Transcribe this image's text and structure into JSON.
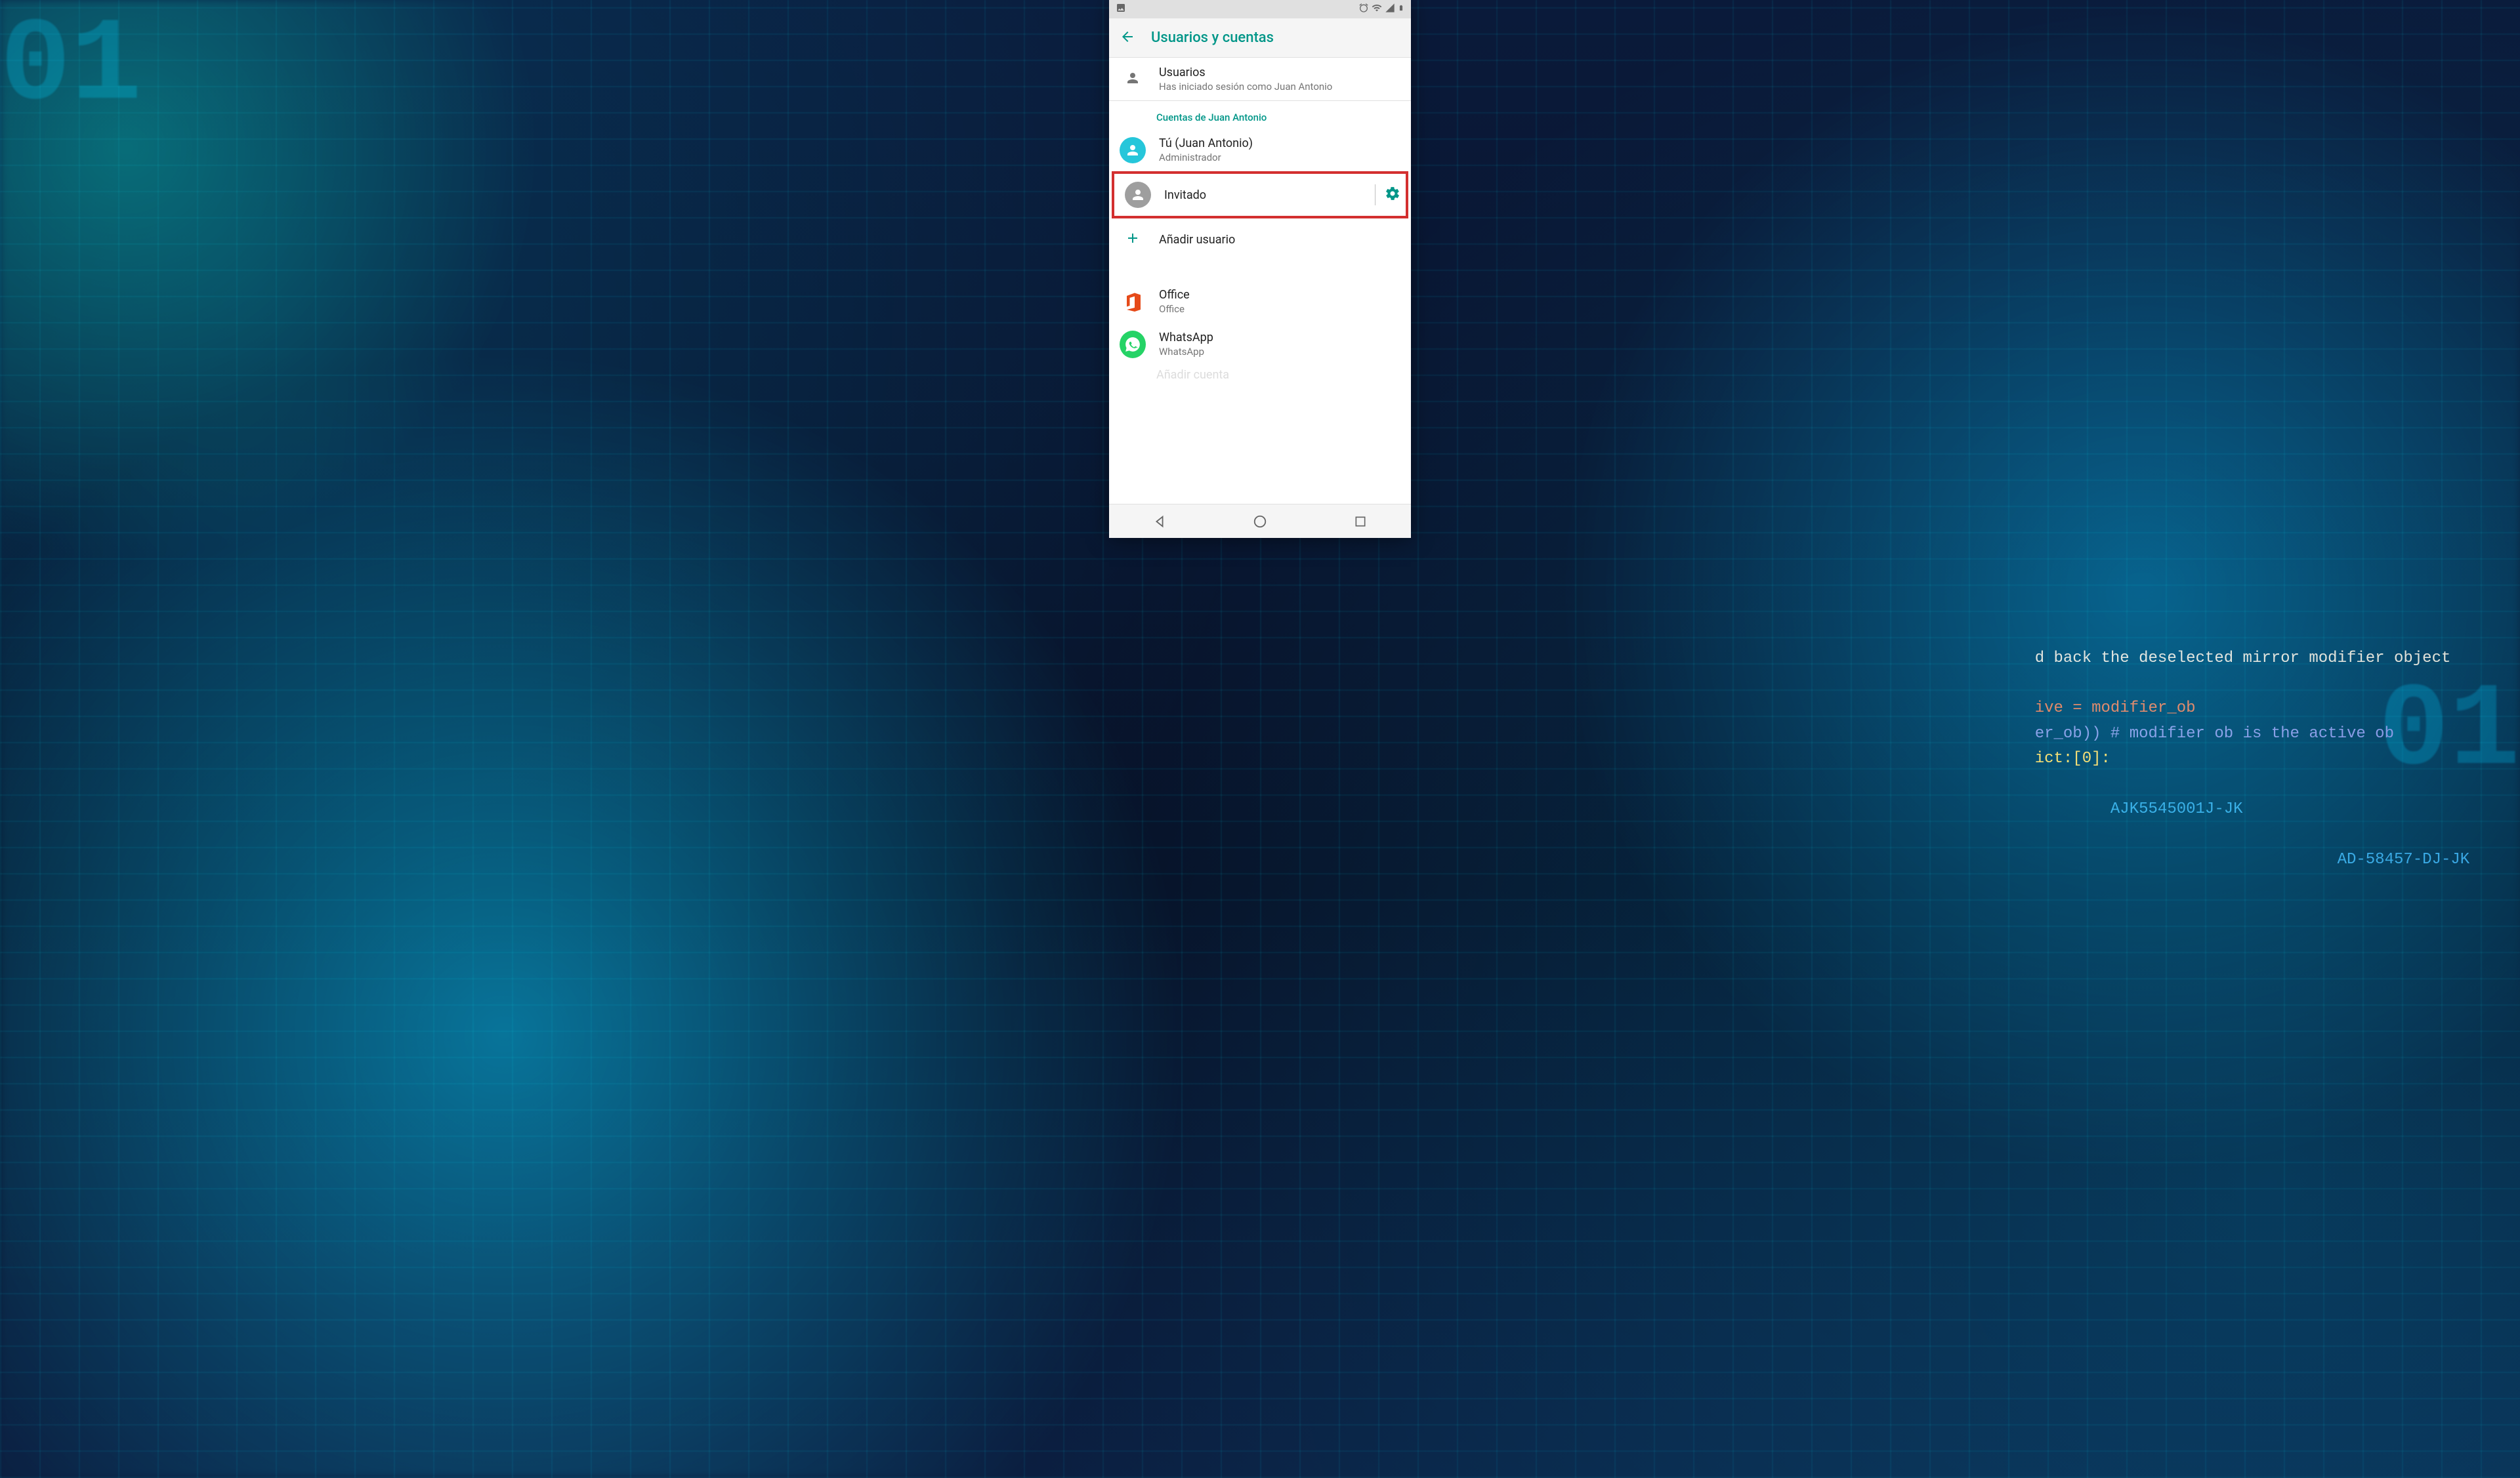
{
  "appbar": {
    "title": "Usuarios y cuentas"
  },
  "users_row": {
    "title": "Usuarios",
    "subtitle": "Has iniciado sesión como Juan Antonio"
  },
  "section_header": "Cuentas de Juan Antonio",
  "accounts": {
    "you": {
      "title": "Tú (Juan Antonio)",
      "subtitle": "Administrador"
    },
    "guest": {
      "title": "Invitado"
    },
    "add_user": {
      "title": "Añadir usuario"
    },
    "office": {
      "title": "Office",
      "subtitle": "Office"
    },
    "whatsapp": {
      "title": "WhatsApp",
      "subtitle": "WhatsApp"
    },
    "add_account_partial": "Añadir cuenta"
  },
  "bg_code": {
    "line1": "d back the deselected mirror modifier object",
    "line2": "ive = modifier_ob",
    "line3": "er_ob)) # modifier ob is the active ob",
    "line4": "ict:[0]:",
    "tag1": "AJK5545001J-JK",
    "tag2": "AD-58457-DJ-JK",
    "bignum_left": "01",
    "bignum_right": "01"
  }
}
